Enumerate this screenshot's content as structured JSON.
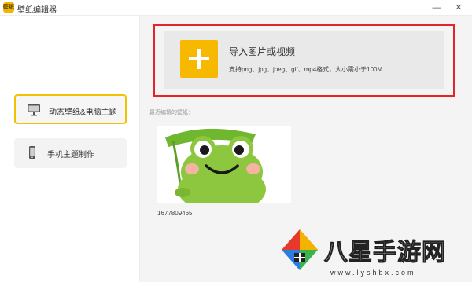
{
  "window": {
    "logo_text": "壁纸",
    "title": "壁纸编辑器",
    "minimize_glyph": "—",
    "close_glyph": "✕"
  },
  "sidebar": {
    "items": [
      {
        "label": "动态壁纸&电脑主题",
        "icon": "monitor-icon",
        "active": true
      },
      {
        "label": "手机主题制作",
        "icon": "phone-icon",
        "active": false
      }
    ]
  },
  "upload": {
    "icon": "plus-icon",
    "title": "导入图片或视频",
    "hint": "支持png、jpg、jpeg、gif、mp4格式，大小需小于100M"
  },
  "recent": {
    "label": "最近编辑的壁纸：",
    "items": [
      {
        "caption": "1677809465",
        "image": "frog-cartoon"
      }
    ]
  },
  "watermark": {
    "text": "八星手游网",
    "url": "www.lyshbx.com"
  },
  "colors": {
    "accent_yellow": "#f7b800",
    "highlight_red": "#e3242b",
    "active_border": "#f2c200",
    "frog_green": "#8dc63f"
  }
}
